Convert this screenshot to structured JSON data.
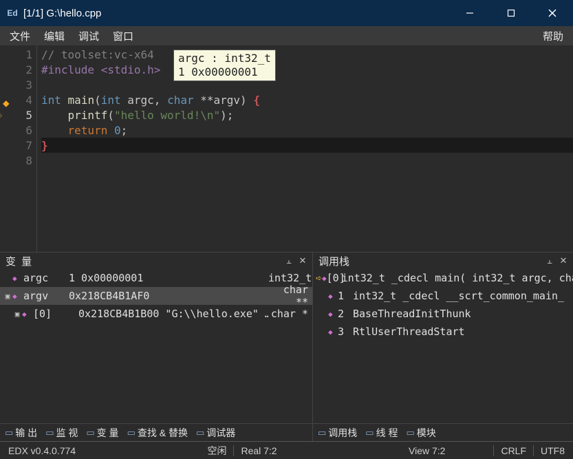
{
  "titlebar": {
    "app_icon_text": "Ed",
    "title": "[1/1] G:\\hello.cpp"
  },
  "menubar": {
    "items": [
      "文件",
      "编辑",
      "调试",
      "窗口"
    ],
    "help": "帮助"
  },
  "editor": {
    "lines": [
      {
        "num": "1",
        "tokens": [
          [
            "comment",
            "// toolset:vc-x64"
          ]
        ]
      },
      {
        "num": "2",
        "tokens": [
          [
            "pp",
            "#include"
          ],
          [
            "punct",
            " "
          ],
          [
            "pp",
            "<stdio.h>"
          ]
        ]
      },
      {
        "num": "3",
        "tokens": []
      },
      {
        "num": "4",
        "breakpoint": true,
        "tokens": [
          [
            "type",
            "int"
          ],
          [
            "punct",
            " "
          ],
          [
            "func",
            "main"
          ],
          [
            "paren",
            "("
          ],
          [
            "type",
            "int"
          ],
          [
            "punct",
            " "
          ],
          [
            "ident",
            "argc"
          ],
          [
            "punct",
            ", "
          ],
          [
            "type",
            "char"
          ],
          [
            "punct",
            " **"
          ],
          [
            "ident",
            "argv"
          ],
          [
            "paren",
            ")"
          ],
          [
            "punct",
            " "
          ],
          [
            "brace",
            "{"
          ]
        ]
      },
      {
        "num": "5",
        "current": true,
        "tokens": [
          [
            "punct",
            "    "
          ],
          [
            "func",
            "printf"
          ],
          [
            "paren",
            "("
          ],
          [
            "string",
            "\"hello world!\\n\""
          ],
          [
            "paren",
            ")"
          ],
          [
            "punct",
            ";"
          ]
        ]
      },
      {
        "num": "6",
        "tokens": [
          [
            "punct",
            "    "
          ],
          [
            "keyword",
            "return"
          ],
          [
            "punct",
            " "
          ],
          [
            "number",
            "0"
          ],
          [
            "punct",
            ";"
          ]
        ]
      },
      {
        "num": "7",
        "cursor": true,
        "tokens": [
          [
            "brace-close",
            "}"
          ]
        ]
      },
      {
        "num": "8",
        "tokens": []
      }
    ],
    "tooltip": {
      "line1": "argc : int32_t",
      "line2": "1 0x00000001"
    }
  },
  "panels": {
    "variables": {
      "title": "变 量",
      "rows": [
        {
          "expand": "",
          "name": "argc",
          "value": "1 0x00000001",
          "type": "int32_t",
          "selected": false,
          "child": false
        },
        {
          "expand": "▣",
          "name": "argv",
          "value": "0x218CB4B1AF0",
          "type": "char **",
          "selected": true,
          "child": false
        },
        {
          "expand": "▣",
          "name": "[0]",
          "value": "0x218CB4B1B00 \"G:\\\\hello.exe\" …",
          "type": "char *",
          "selected": false,
          "child": true
        }
      ]
    },
    "callstack": {
      "title": "调用栈",
      "rows": [
        {
          "current": true,
          "idx": "[0]",
          "name": "int32_t _cdecl main( int32_t argc, cha"
        },
        {
          "current": false,
          "idx": "1",
          "name": "int32_t _cdecl __scrt_common_main_"
        },
        {
          "current": false,
          "idx": "2",
          "name": "BaseThreadInitThunk"
        },
        {
          "current": false,
          "idx": "3",
          "name": "RtlUserThreadStart"
        }
      ]
    },
    "left_tabs": [
      "输 出",
      "监 视",
      "变 量",
      "查找 & 替换",
      "调试器"
    ],
    "right_tabs": [
      "调用栈",
      "线 程",
      "模块"
    ]
  },
  "statusbar": {
    "version": "EDX v0.4.0.774",
    "idle": "空闲",
    "real": "Real 7:2",
    "view": "View 7:2",
    "eol": "CRLF",
    "encoding": "UTF8"
  }
}
